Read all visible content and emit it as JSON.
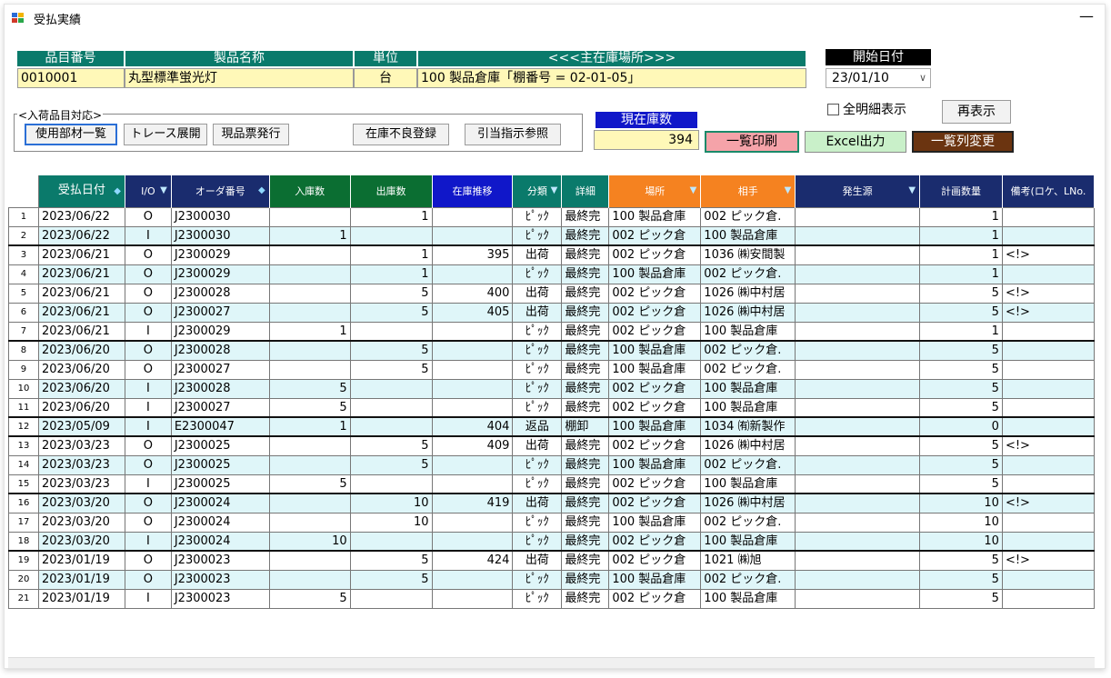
{
  "window": {
    "title": "受払実績",
    "minimize": "—"
  },
  "item": {
    "headers": {
      "code": "品目番号",
      "name": "製品名称",
      "unit": "単位",
      "location": "<<<主在庫場所>>>"
    },
    "code": "0010001",
    "name": "丸型標準蛍光灯",
    "unit": "台",
    "location": "100 製品倉庫「棚番号 = 02-01-05」"
  },
  "start_date": {
    "label": "開始日付",
    "value": "23/01/10",
    "chevron": "∨"
  },
  "incoming_group": {
    "label": "<入荷品目対応>",
    "buttons": [
      "使用部材一覧",
      "トレース展開",
      "現品票発行"
    ]
  },
  "buttons": {
    "defect": "在庫不良登録",
    "allocation": "引当指示参照",
    "print_list": "一覧印刷",
    "excel": "Excel出力",
    "column_change": "一覧列変更",
    "redisplay": "再表示"
  },
  "stock": {
    "label": "現在庫数",
    "value": "394"
  },
  "show_all_details": {
    "label": "全明細表示",
    "checked": false
  },
  "colors": {
    "teal": "#0a7a6b",
    "yellow": "#fff8b8",
    "navy": "#1a2c6e",
    "orange": "#f58220",
    "green": "#0b6e32",
    "blue": "#1017c9",
    "row_alt": "#dff6f9",
    "print_btn": "#f5a3a9",
    "excel_btn": "#c9f0c9",
    "colchange_btn": "#6b3410"
  },
  "table": {
    "columns": [
      {
        "label": "受払日付",
        "bg": "#0a7a6b",
        "mark": "sort"
      },
      {
        "label": "I/O",
        "bg": "#1a2c6e",
        "mark": "filter"
      },
      {
        "label": "オーダ番号",
        "bg": "#1a2c6e",
        "mark": "sort"
      },
      {
        "label": "入庫数",
        "bg": "#0b6e32"
      },
      {
        "label": "出庫数",
        "bg": "#0b6e32"
      },
      {
        "label": "在庫推移",
        "bg": "#1017c9"
      },
      {
        "label": "分類",
        "bg": "#0a7a6b",
        "mark": "filter"
      },
      {
        "label": "詳細",
        "bg": "#0a7a6b"
      },
      {
        "label": "場所",
        "bg": "#f58220",
        "mark": "filter"
      },
      {
        "label": "相手",
        "bg": "#f58220",
        "mark": "filter"
      },
      {
        "label": "発生源",
        "bg": "#1a2c6e",
        "mark": "filter"
      },
      {
        "label": "計画数量",
        "bg": "#1a2c6e"
      },
      {
        "label": "備考(ロケ、LNo.",
        "bg": "#1a2c6e"
      }
    ],
    "rows": [
      {
        "n": "1",
        "date": "2023/06/22",
        "io": "O",
        "order": "J2300030",
        "in": "",
        "out": "1",
        "trend": "",
        "cls": "ﾋﾟｯｸ",
        "detail": "最終完",
        "place": "100 製品倉庫",
        "partner": "002 ピック倉.",
        "src": "",
        "plan": "1",
        "note": "",
        "sep": false
      },
      {
        "n": "2",
        "date": "2023/06/22",
        "io": "I",
        "order": "J2300030",
        "in": "1",
        "out": "",
        "trend": "",
        "cls": "ﾋﾟｯｸ",
        "detail": "最終完",
        "place": "002 ピック倉",
        "partner": "100 製品倉庫",
        "src": "",
        "plan": "1",
        "note": "",
        "sep": false
      },
      {
        "n": "3",
        "date": "2023/06/21",
        "io": "O",
        "order": "J2300029",
        "in": "",
        "out": "1",
        "trend": "395",
        "cls": "出荷",
        "detail": "最終完",
        "place": "002 ピック倉",
        "partner": "1036 ㈱安間製",
        "src": "",
        "plan": "1",
        "note": "<!>",
        "sep": true
      },
      {
        "n": "4",
        "date": "2023/06/21",
        "io": "O",
        "order": "J2300029",
        "in": "",
        "out": "1",
        "trend": "",
        "cls": "ﾋﾟｯｸ",
        "detail": "最終完",
        "place": "100 製品倉庫",
        "partner": "002 ピック倉.",
        "src": "",
        "plan": "1",
        "note": "",
        "sep": false
      },
      {
        "n": "5",
        "date": "2023/06/21",
        "io": "O",
        "order": "J2300028",
        "in": "",
        "out": "5",
        "trend": "400",
        "cls": "出荷",
        "detail": "最終完",
        "place": "002 ピック倉",
        "partner": "1026 ㈱中村居",
        "src": "",
        "plan": "5",
        "note": "<!>",
        "sep": false
      },
      {
        "n": "6",
        "date": "2023/06/21",
        "io": "O",
        "order": "J2300027",
        "in": "",
        "out": "5",
        "trend": "405",
        "cls": "出荷",
        "detail": "最終完",
        "place": "002 ピック倉",
        "partner": "1026 ㈱中村居",
        "src": "",
        "plan": "5",
        "note": "<!>",
        "sep": false
      },
      {
        "n": "7",
        "date": "2023/06/21",
        "io": "I",
        "order": "J2300029",
        "in": "1",
        "out": "",
        "trend": "",
        "cls": "ﾋﾟｯｸ",
        "detail": "最終完",
        "place": "002 ピック倉",
        "partner": "100 製品倉庫",
        "src": "",
        "plan": "1",
        "note": "",
        "sep": false
      },
      {
        "n": "8",
        "date": "2023/06/20",
        "io": "O",
        "order": "J2300028",
        "in": "",
        "out": "5",
        "trend": "",
        "cls": "ﾋﾟｯｸ",
        "detail": "最終完",
        "place": "100 製品倉庫",
        "partner": "002 ピック倉.",
        "src": "",
        "plan": "5",
        "note": "",
        "sep": true
      },
      {
        "n": "9",
        "date": "2023/06/20",
        "io": "O",
        "order": "J2300027",
        "in": "",
        "out": "5",
        "trend": "",
        "cls": "ﾋﾟｯｸ",
        "detail": "最終完",
        "place": "100 製品倉庫",
        "partner": "002 ピック倉.",
        "src": "",
        "plan": "5",
        "note": "",
        "sep": false
      },
      {
        "n": "10",
        "date": "2023/06/20",
        "io": "I",
        "order": "J2300028",
        "in": "5",
        "out": "",
        "trend": "",
        "cls": "ﾋﾟｯｸ",
        "detail": "最終完",
        "place": "002 ピック倉",
        "partner": "100 製品倉庫",
        "src": "",
        "plan": "5",
        "note": "",
        "sep": false
      },
      {
        "n": "11",
        "date": "2023/06/20",
        "io": "I",
        "order": "J2300027",
        "in": "5",
        "out": "",
        "trend": "",
        "cls": "ﾋﾟｯｸ",
        "detail": "最終完",
        "place": "002 ピック倉",
        "partner": "100 製品倉庫",
        "src": "",
        "plan": "5",
        "note": "",
        "sep": false
      },
      {
        "n": "12",
        "date": "2023/05/09",
        "io": "I",
        "order": "E2300047",
        "in": "1",
        "out": "",
        "trend": "404",
        "cls": "返品",
        "detail": "棚卸",
        "place": "100 製品倉庫",
        "partner": "1034 ㈲新製作",
        "src": "",
        "plan": "0",
        "note": "",
        "sep": true
      },
      {
        "n": "13",
        "date": "2023/03/23",
        "io": "O",
        "order": "J2300025",
        "in": "",
        "out": "5",
        "trend": "409",
        "cls": "出荷",
        "detail": "最終完",
        "place": "002 ピック倉",
        "partner": "1026 ㈱中村居",
        "src": "",
        "plan": "5",
        "note": "<!>",
        "sep": true
      },
      {
        "n": "14",
        "date": "2023/03/23",
        "io": "O",
        "order": "J2300025",
        "in": "",
        "out": "5",
        "trend": "",
        "cls": "ﾋﾟｯｸ",
        "detail": "最終完",
        "place": "100 製品倉庫",
        "partner": "002 ピック倉.",
        "src": "",
        "plan": "5",
        "note": "",
        "sep": false
      },
      {
        "n": "15",
        "date": "2023/03/23",
        "io": "I",
        "order": "J2300025",
        "in": "5",
        "out": "",
        "trend": "",
        "cls": "ﾋﾟｯｸ",
        "detail": "最終完",
        "place": "002 ピック倉",
        "partner": "100 製品倉庫",
        "src": "",
        "plan": "5",
        "note": "",
        "sep": false
      },
      {
        "n": "16",
        "date": "2023/03/20",
        "io": "O",
        "order": "J2300024",
        "in": "",
        "out": "10",
        "trend": "419",
        "cls": "出荷",
        "detail": "最終完",
        "place": "002 ピック倉",
        "partner": "1026 ㈱中村居",
        "src": "",
        "plan": "10",
        "note": "<!>",
        "sep": true
      },
      {
        "n": "17",
        "date": "2023/03/20",
        "io": "O",
        "order": "J2300024",
        "in": "",
        "out": "10",
        "trend": "",
        "cls": "ﾋﾟｯｸ",
        "detail": "最終完",
        "place": "100 製品倉庫",
        "partner": "002 ピック倉.",
        "src": "",
        "plan": "10",
        "note": "",
        "sep": false
      },
      {
        "n": "18",
        "date": "2023/03/20",
        "io": "I",
        "order": "J2300024",
        "in": "10",
        "out": "",
        "trend": "",
        "cls": "ﾋﾟｯｸ",
        "detail": "最終完",
        "place": "002 ピック倉",
        "partner": "100 製品倉庫",
        "src": "",
        "plan": "10",
        "note": "",
        "sep": false
      },
      {
        "n": "19",
        "date": "2023/01/19",
        "io": "O",
        "order": "J2300023",
        "in": "",
        "out": "5",
        "trend": "424",
        "cls": "出荷",
        "detail": "最終完",
        "place": "002 ピック倉",
        "partner": "1021 ㈱旭",
        "src": "",
        "plan": "5",
        "note": "<!>",
        "sep": true
      },
      {
        "n": "20",
        "date": "2023/01/19",
        "io": "O",
        "order": "J2300023",
        "in": "",
        "out": "5",
        "trend": "",
        "cls": "ﾋﾟｯｸ",
        "detail": "最終完",
        "place": "100 製品倉庫",
        "partner": "002 ピック倉.",
        "src": "",
        "plan": "5",
        "note": "",
        "sep": false
      },
      {
        "n": "21",
        "date": "2023/01/19",
        "io": "I",
        "order": "J2300023",
        "in": "5",
        "out": "",
        "trend": "",
        "cls": "ﾋﾟｯｸ",
        "detail": "最終完",
        "place": "002 ピック倉",
        "partner": "100 製品倉庫",
        "src": "",
        "plan": "5",
        "note": "",
        "sep": false
      }
    ]
  }
}
